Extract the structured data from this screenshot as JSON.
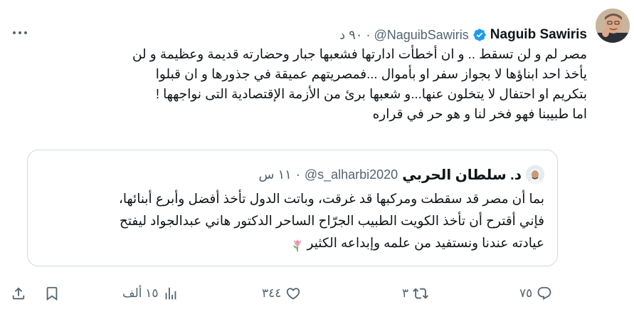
{
  "tweet": {
    "author_name": "Naguib Sawiris",
    "author_handle": "@NaguibSawiris",
    "separator": "·",
    "time": "٩٠ د",
    "text_lines": [
      "مصر لم و لن تسقط .. و ان أخطأت ادارتها فشعبها جبار وحضارته قديمة وعظيمة و لن",
      "يأخذ احد ابناؤها لا بجواز سفر او بأموال ...فمصريتهم عميقة في جذورها و ان قبلوا",
      "بتكريم او احتفال لا يتخلون عنها...و شعبها برئ من الأزمة الإقتصادية التى نواجهها !",
      "اما طبيبنا فهو فخر لنا و هو حر في قراره"
    ]
  },
  "quote": {
    "author_name": "د. سلطان الحربي",
    "author_handle": "@s_alharbi2020",
    "separator": "·",
    "time": "١١ س",
    "text_lines": [
      "بما أن مصر قد سقطت ومركبها قد غرقت، وباتت الدول تأخذ أفضل وأبرع أبنائها،",
      "فإني أقترح أن تأخذ الكويت الطبيب الجرّاح الساحر الدكتور هاني عبدالجواد ليفتح",
      "عيادته عندنا ونستفيد من علمه وإبداعه الكثير"
    ],
    "emoji": "tulip"
  },
  "actions": {
    "replies": "٧٥",
    "retweets": "٣",
    "likes": "٣٤٤",
    "views": "١٥ ألف"
  },
  "icons": {
    "verified": "verified-badge-icon",
    "more": "more-dots-icon",
    "reply": "reply-icon",
    "retweet": "retweet-icon",
    "like": "heart-icon",
    "views": "views-icon",
    "bookmark": "bookmark-icon",
    "share": "share-icon"
  },
  "colors": {
    "text": "#0f1419",
    "secondary": "#536471",
    "verified": "#1d9bf0",
    "border": "#cfd9de"
  }
}
